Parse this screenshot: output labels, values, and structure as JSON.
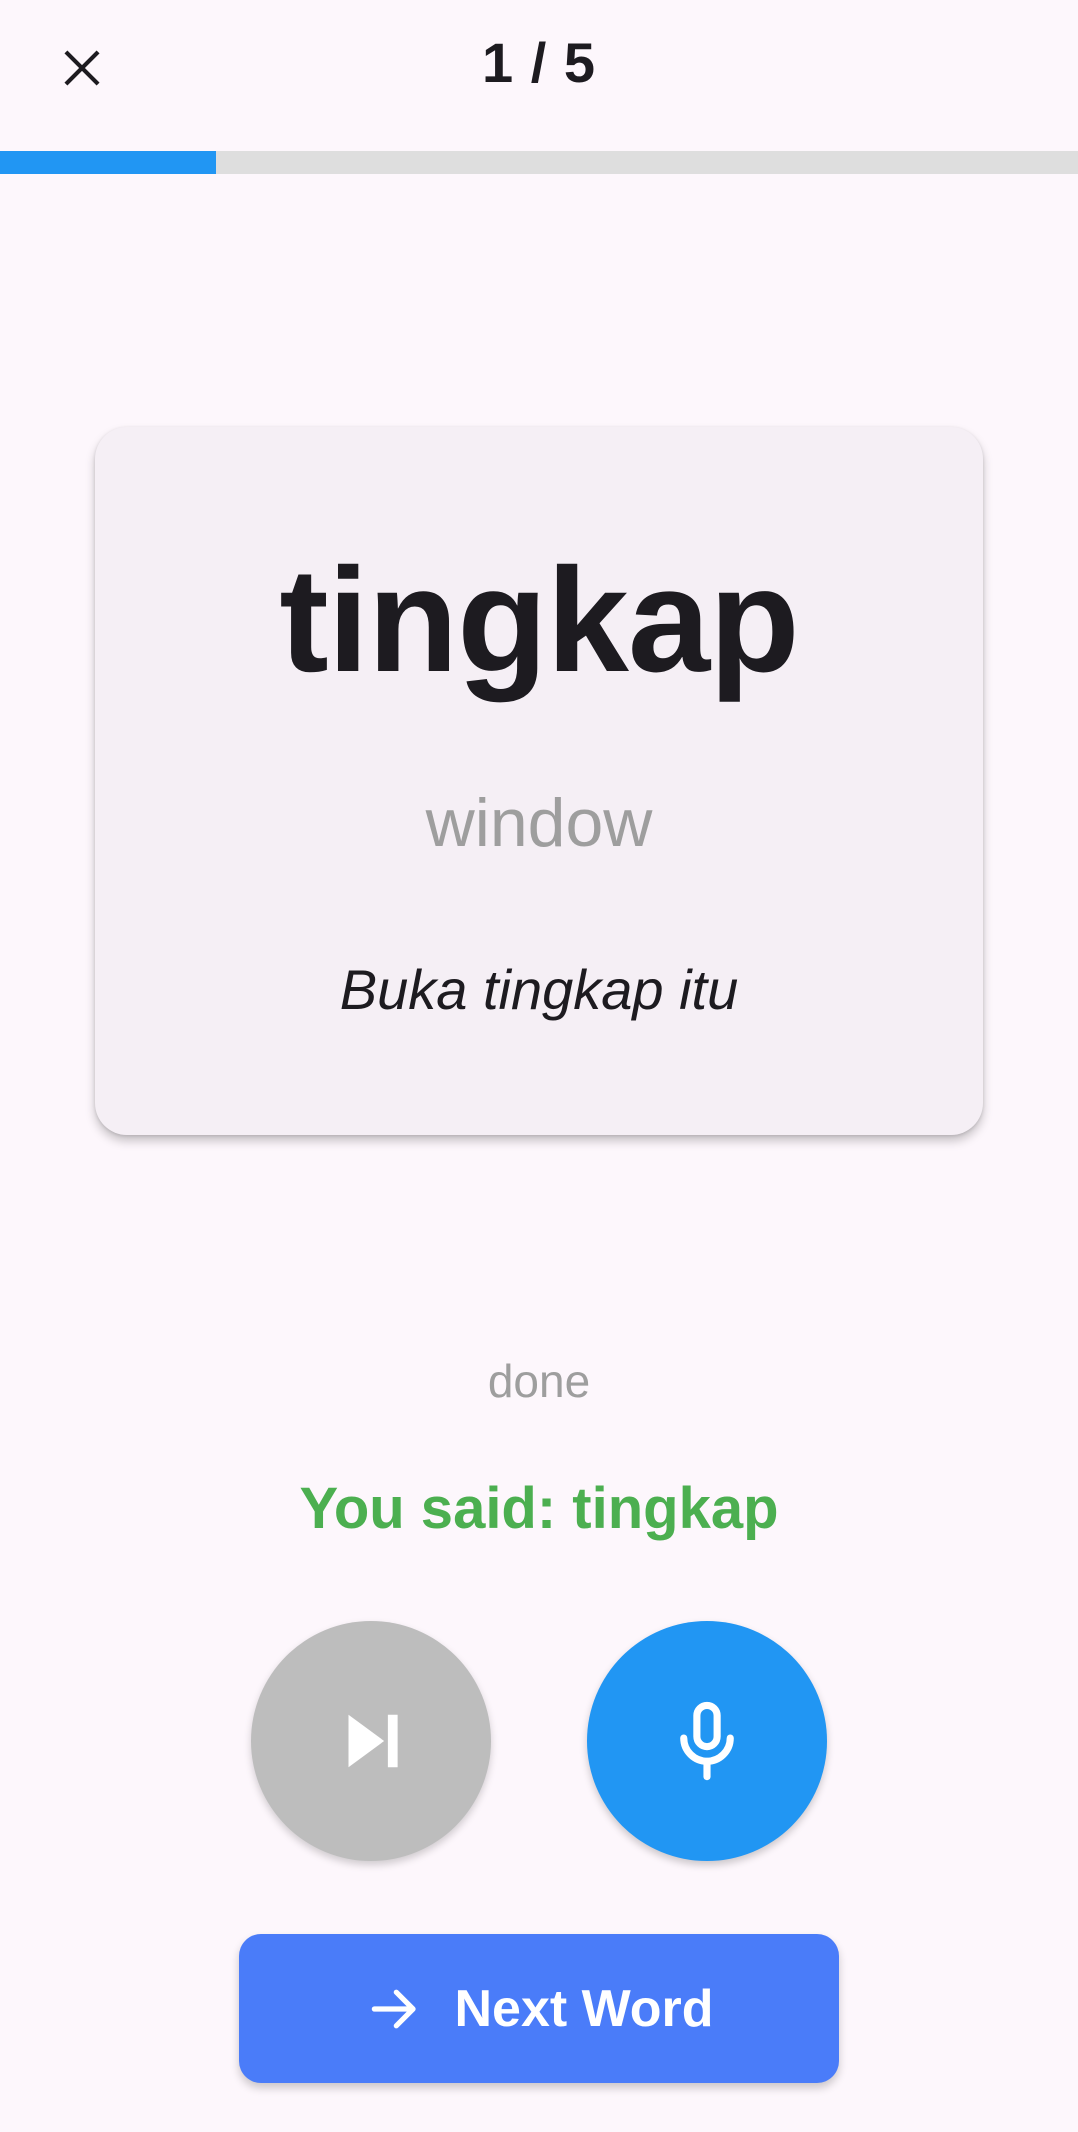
{
  "header": {
    "progress_label": "1 / 5",
    "progress_fraction": 0.2
  },
  "card": {
    "word": "tingkap",
    "translation": "window",
    "example": "Buka tingkap itu"
  },
  "status": {
    "text": "done",
    "recognized": "You said: tingkap"
  },
  "controls": {
    "skip_icon": "skip-next-icon",
    "mic_icon": "microphone-icon",
    "next_icon": "arrow-right-icon",
    "next_label": "Next Word"
  },
  "colors": {
    "background": "#FDF7FC",
    "accent": "#2196F3",
    "progress_track": "#DEDEDE",
    "card": "#F5EFF5",
    "success": "#4CAF50",
    "next_button": "#4A7CF9",
    "skip_button": "#BDBDBD"
  }
}
